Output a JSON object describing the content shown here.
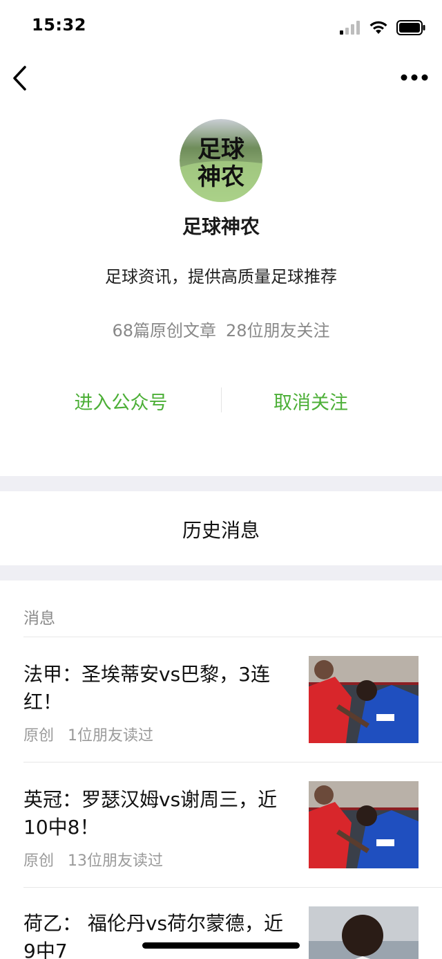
{
  "status_bar": {
    "time": "15:32"
  },
  "account": {
    "name": "足球神农",
    "avatar_text_line1": "足球",
    "avatar_text_line2": "神农",
    "description": "足球资讯，提供高质量足球推荐",
    "original_articles": "68篇原创文章",
    "friends_following": "28位朋友关注"
  },
  "actions": {
    "enter_account": "进入公众号",
    "unfollow": "取消关注"
  },
  "history": {
    "title": "历史消息",
    "section_label": "消息",
    "articles": [
      {
        "title": "法甲：圣埃蒂安vs巴黎，3连红！",
        "tag": "原创",
        "reads": "1位朋友读过",
        "thumb": "football-players-photo"
      },
      {
        "title": "英冠：罗瑟汉姆vs谢周三，近10中8！",
        "tag": "原创",
        "reads": "13位朋友读过",
        "thumb": "football-players-photo"
      },
      {
        "title": "荷乙： 福伦丹vs荷尔蒙德，近9中7",
        "tag": "",
        "reads": "",
        "thumb": "football-player-portrait"
      }
    ]
  },
  "colors": {
    "accent_green": "#4caf37",
    "band_gray": "#efeff4",
    "meta_gray": "#9a9a9a"
  }
}
